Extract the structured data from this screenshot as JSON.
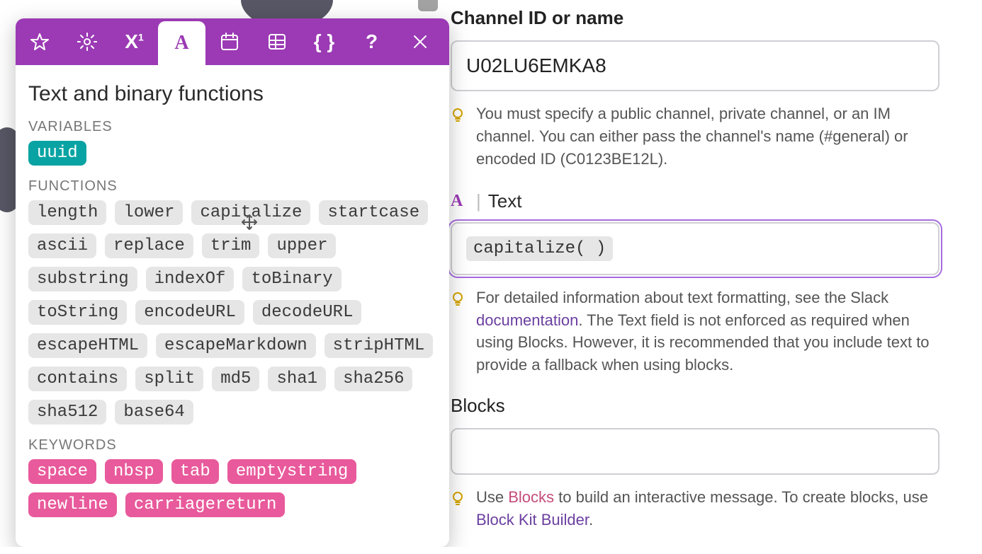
{
  "panel": {
    "title": "Text and binary functions",
    "section_variables": "VARIABLES",
    "section_functions": "FUNCTIONS",
    "section_keywords": "KEYWORDS",
    "variables": [
      "uuid"
    ],
    "functions": [
      "length",
      "lower",
      "capitalize",
      "startcase",
      "ascii",
      "replace",
      "trim",
      "upper",
      "substring",
      "indexOf",
      "toBinary",
      "toString",
      "encodeURL",
      "decodeURL",
      "escapeHTML",
      "escapeMarkdown",
      "stripHTML",
      "contains",
      "split",
      "md5",
      "sha1",
      "sha256",
      "sha512",
      "base64"
    ],
    "keywords": [
      "space",
      "nbsp",
      "tab",
      "emptystring",
      "newline",
      "carriagereturn"
    ]
  },
  "toolbar": {
    "tabs": [
      "star",
      "settings",
      "math",
      "text",
      "calendar",
      "table",
      "braces",
      "help",
      "close"
    ],
    "active_index": 3
  },
  "right": {
    "channel": {
      "label": "Channel ID or name",
      "value": "U02LU6EMKA8",
      "hint1": "You must specify a public channel, private channel, or an IM channel. You can either pass the channel's name (#general) or encoded ID (C0123BE12L)."
    },
    "text": {
      "label": "Text",
      "token": "capitalize(  )",
      "hint_before": "For detailed information about text formatting, see the Slack ",
      "hint_link": "documentation",
      "hint_after": ". The Text field is not enforced as required when using Blocks. However, it is recommended that you include text to provide a fallback when using blocks."
    },
    "blocks": {
      "label": "Blocks",
      "hint_before": "Use ",
      "hint_link1": "Blocks",
      "hint_mid": " to build an interactive message. To create blocks, use ",
      "hint_link2": "Block Kit Builder",
      "hint_after": "."
    }
  }
}
